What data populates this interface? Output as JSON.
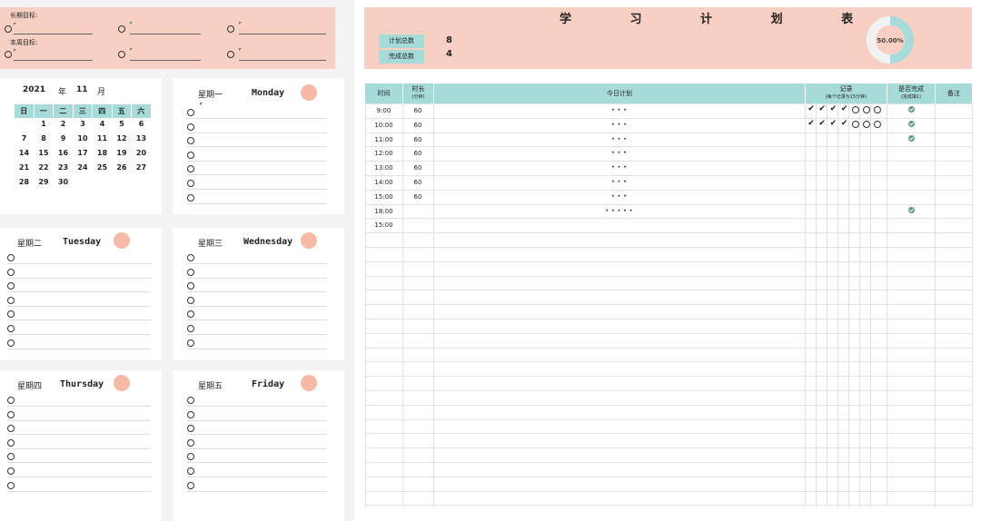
{
  "goals": {
    "long_label": "长期目标:",
    "week_label": "本周目标:"
  },
  "calendar": {
    "year": "2021",
    "year_unit": "年",
    "month": "11",
    "month_unit": "月",
    "weekdays": [
      "日",
      "一",
      "二",
      "三",
      "四",
      "五",
      "六"
    ],
    "weeks": [
      [
        "",
        "1",
        "2",
        "3",
        "4",
        "5",
        "6"
      ],
      [
        "7",
        "8",
        "9",
        "10",
        "11",
        "12",
        "13"
      ],
      [
        "14",
        "15",
        "16",
        "17",
        "18",
        "19",
        "20"
      ],
      [
        "21",
        "22",
        "23",
        "24",
        "25",
        "26",
        "27"
      ],
      [
        "28",
        "29",
        "30",
        "",
        "",
        "",
        ""
      ]
    ]
  },
  "days": {
    "mon": {
      "cn": "星期一",
      "en": "Monday"
    },
    "tue": {
      "cn": "星期二",
      "en": "Tuesday"
    },
    "wed": {
      "cn": "星期三",
      "en": "Wednesday"
    },
    "thu": {
      "cn": "星期四",
      "en": "Thursday"
    },
    "fri": {
      "cn": "星期五",
      "en": "Friday"
    }
  },
  "plan": {
    "title": "学 习 计 划 表",
    "total_label": "计划总数",
    "total_value": "8",
    "done_label": "完成总数",
    "done_value": "4",
    "percent_label": "50.00%",
    "percent": 0.5,
    "ring_color": "#a7dbda",
    "ring_bg": "#f2f2f2"
  },
  "table": {
    "headers": {
      "time": "时间",
      "duration": "时长",
      "duration_sub": "(分钟)",
      "plan": "今日计划",
      "record": "记录",
      "record_sub": "(每个记录为15分钟)",
      "done": "是否完成",
      "done_sub": "(完成填1)",
      "note": "备注"
    },
    "rows": [
      {
        "time": "9:00",
        "duration": "60",
        "plan": "· · ·",
        "record": [
          "✔",
          "✔",
          "✔",
          "✔",
          "○",
          "○",
          "○"
        ],
        "done": true
      },
      {
        "time": "10:00",
        "duration": "60",
        "plan": "· · ·",
        "record": [
          "✔",
          "✔",
          "✔",
          "✔",
          "○",
          "○",
          "○"
        ],
        "done": true
      },
      {
        "time": "11:00",
        "duration": "60",
        "plan": "· · ·",
        "record": [],
        "done": true
      },
      {
        "time": "12:00",
        "duration": "60",
        "plan": "· · ·",
        "record": [],
        "done": false
      },
      {
        "time": "13:00",
        "duration": "60",
        "plan": "· · ·",
        "record": [],
        "done": false
      },
      {
        "time": "14:00",
        "duration": "60",
        "plan": "· · ·",
        "record": [],
        "done": false
      },
      {
        "time": "15:00",
        "duration": "60",
        "plan": "· · ·",
        "record": [],
        "done": false
      },
      {
        "time": "18:00",
        "duration": "",
        "plan": "· · · · ·",
        "record": [],
        "done": true
      },
      {
        "time": "15:00",
        "duration": "",
        "plan": "",
        "record": [],
        "done": false
      }
    ]
  }
}
